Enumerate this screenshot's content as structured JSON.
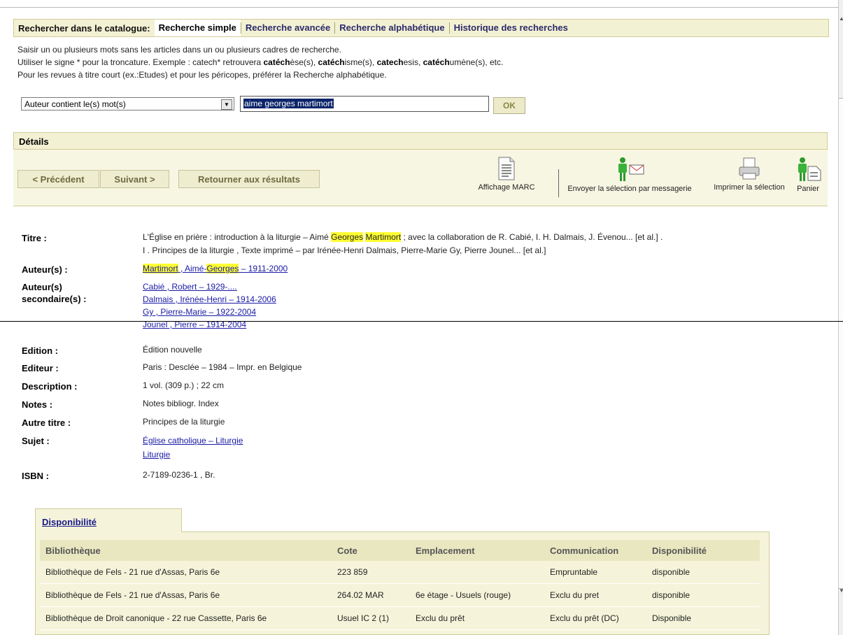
{
  "search": {
    "heading": "Rechercher dans le catalogue:",
    "tabs": [
      "Recherche simple",
      "Recherche avancée",
      "Recherche alphabétique",
      "Historique des recherches"
    ],
    "help_line1": "Saisir un ou plusieurs mots sans les articles dans un ou plusieurs cadres de recherche.",
    "help_line2_prefix": "Utiliser le signe * pour la troncature. Exemple : catech* retrouvera ",
    "help_line2_examples": [
      "catéch",
      "èse(s), ",
      "catéch",
      "isme(s), ",
      "catech",
      "esis, ",
      "catéch",
      "umène(s), etc."
    ],
    "help_line3": "Pour les revues à titre court (ex.:Etudes) et pour les péricopes, préférer la Recherche alphabétique.",
    "field_selected": "Auteur contient le(s) mot(s)",
    "query_value": "aime georges martimort",
    "ok_label": "OK"
  },
  "details": {
    "heading": "Détails",
    "prev_label": "< Précédent",
    "next_label": "Suivant >",
    "back_label": "Retourner aux résultats",
    "actions": {
      "marc": "Affichage MARC",
      "email": "Envoyer la sélection par messagerie",
      "print": "Imprimer la sélection",
      "basket": "Panier"
    }
  },
  "record": {
    "labels": {
      "title": "Titre :",
      "authors": "Auteur(s) :",
      "secondary1": "Auteur(s)",
      "secondary2": "secondaire(s) :",
      "edition": "Edition :",
      "publisher": "Editeur :",
      "description": "Description :",
      "notes": "Notes :",
      "other_title": "Autre titre :",
      "subject": "Sujet :",
      "isbn": "ISBN :"
    },
    "title_part1": "L'Église en prière : introduction à la liturgie – Aimé ",
    "title_hl1": "Georges",
    "title_hl2": "Martimort",
    "title_part2": " ; avec la collaboration de R. Cabié, I. H. Dalmais, J. Évenou... [et al.] .",
    "title_line2": "I . Principes de la liturgie , Texte imprimé – par Irénée-Henri Dalmais, Pierre-Marie Gy, Pierre Jounel... [et al.]",
    "author_hl1": "Martimort",
    "author_mid": " , Aimé-",
    "author_hl2": "Georges",
    "author_tail": " – 1911-2000",
    "secondary_authors": [
      "Cabié , Robert – 1929-....",
      "Dalmais , Irénée-Henri – 1914-2006",
      "Gy , Pierre-Marie – 1922-2004",
      "Jounel , Pierre – 1914-2004"
    ],
    "edition": "Édition nouvelle",
    "publisher": "Paris : Desclée – 1984 – Impr. en Belgique",
    "description": "1 vol. (309 p.) ; 22 cm",
    "notes": "Notes bibliogr. Index",
    "other_title": "Principes de la liturgie",
    "subjects": [
      "Église catholique – Liturgie",
      "Liturgie"
    ],
    "isbn": "2-7189-0236-1 , Br."
  },
  "availability": {
    "tab_label": "Disponibilité",
    "headers": [
      "Bibliothèque",
      "Cote",
      "Emplacement",
      "Communication",
      "Disponibilité"
    ],
    "rows": [
      [
        "Bibliothèque de Fels - 21 rue d'Assas, Paris 6e",
        "223 859",
        "",
        "Empruntable",
        "disponible"
      ],
      [
        "Bibliothèque de Fels - 21 rue d'Assas, Paris 6e",
        "264.02 MAR",
        "6e étage - Usuels (rouge)",
        "Exclu du pret",
        "disponible"
      ],
      [
        "Bibliothèque de Droit canonique - 22 rue Cassette, Paris 6e",
        "Usuel IC 2 (1)",
        "Exclu du prêt",
        "Exclu du prêt (DC)",
        "Disponible"
      ]
    ]
  }
}
